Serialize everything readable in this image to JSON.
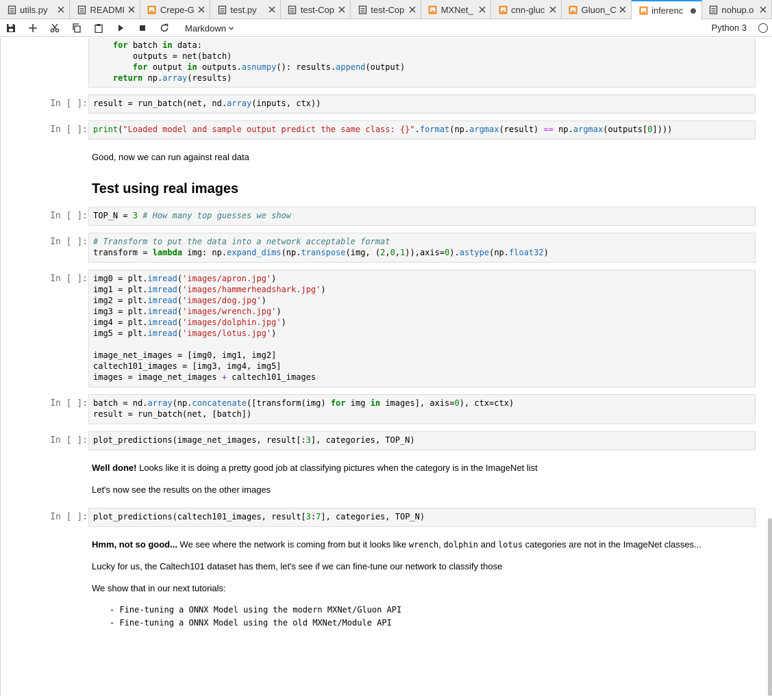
{
  "tabs": [
    {
      "label": "utils.py",
      "icon": "file-icon",
      "active": false
    },
    {
      "label": "READMI",
      "icon": "file-icon",
      "active": false
    },
    {
      "label": "Crepe-G",
      "icon": "notebook-icon",
      "active": false
    },
    {
      "label": "test.py",
      "icon": "file-icon",
      "active": false
    },
    {
      "label": "test-Cop",
      "icon": "file-icon",
      "active": false
    },
    {
      "label": "test-Cop",
      "icon": "file-icon",
      "active": false
    },
    {
      "label": "MXNet_",
      "icon": "notebook-icon",
      "active": false
    },
    {
      "label": "cnn-gluc",
      "icon": "notebook-icon",
      "active": false
    },
    {
      "label": "Gluon_C",
      "icon": "notebook-icon",
      "active": false
    },
    {
      "label": "inferenc",
      "icon": "notebook-icon",
      "active": true
    },
    {
      "label": "nohup.o",
      "icon": "file-icon",
      "active": false
    }
  ],
  "toolbar": {
    "cell_type": "Markdown",
    "kernel_name": "Python 3",
    "icons": [
      "save-icon",
      "add-cell-icon",
      "cut-icon",
      "copy-icon",
      "paste-icon",
      "run-icon",
      "stop-icon",
      "restart-icon"
    ]
  },
  "prompt_label": "In [ ]:",
  "markdown": {
    "good_now": "Good, now we can run against real data",
    "heading": "Test using real images",
    "well_done_bold": "Well done!",
    "well_done_rest": " Looks like it is doing a pretty good job at classifying pictures when the category is in the ImageNet list",
    "lets_now": "Let's now see the results on the other images",
    "hmm_bold": "Hmm, not so good...",
    "hmm_text1": " We see where the network is coming from but it looks like ",
    "hmm_code1": "wrench",
    "hmm_text2": ", ",
    "hmm_code2": "dolphin",
    "hmm_text3": " and ",
    "hmm_code3": "lotus",
    "hmm_text4": " categories are not in the ImageNet classes...",
    "lucky": "Lucky for us, the Caltech101 dataset has them, let's see if we can fine-tune our network to classify those",
    "we_show": "We show that in our next tutorials:",
    "list_item_1": "- Fine-tuning a ONNX Model using the modern MXNet/Gluon API",
    "list_item_2": "- Fine-tuning a ONNX Model using the old MXNet/Module API"
  },
  "code": {
    "c0_l1_kw": "for",
    "c0_l1_a": " batch ",
    "c0_l1_kw2": "in",
    "c0_l1_b": " data:",
    "c0_l2": "    outputs = net(batch)",
    "c0_l3_kw": "for",
    "c0_l3_a": " output ",
    "c0_l3_kw2": "in",
    "c0_l3_b": " outputs.",
    "c0_l3_f": "asnumpy",
    "c0_l3_c": "(): results.",
    "c0_l3_f2": "append",
    "c0_l3_d": "(output)",
    "c0_l4_kw": "return",
    "c0_l4_a": " np.",
    "c0_l4_f": "array",
    "c0_l4_b": "(results)",
    "c1_a": "result = run_batch(net, nd.",
    "c1_f": "array",
    "c1_b": "(inputs, ctx))",
    "c2_f": "print",
    "c2_a": "(",
    "c2_s": "\"Loaded model and sample output predict the same class: {}\"",
    "c2_b": ".",
    "c2_f2": "format",
    "c2_c": "(np.",
    "c2_f3": "argmax",
    "c2_d": "(result) ",
    "c2_o": "==",
    "c2_e": " np.",
    "c2_f4": "argmax",
    "c2_g": "(outputs[",
    "c2_n": "0",
    "c2_h": "])))",
    "c3_a": "TOP_N = ",
    "c3_n": "3",
    "c3_c": " # How many top guesses we show",
    "c4_c": "# Transform to put the data into a network acceptable format",
    "c4_a": "transform = ",
    "c4_k": "lambda",
    "c4_b": " img: np.",
    "c4_f1": "expand_dims",
    "c4_c2": "(np.",
    "c4_f2": "transpose",
    "c4_d": "(img, (",
    "c4_n1": "2",
    "c4_e": ",",
    "c4_n2": "0",
    "c4_g": ",",
    "c4_n3": "1",
    "c4_h": ")),axis=",
    "c4_n4": "0",
    "c4_i": ").",
    "c4_f3": "astype",
    "c4_j": "(np.",
    "c4_f4": "float32",
    "c4_l": ")",
    "c5_imgs": [
      {
        "var": "img0",
        "path": "'images/apron.jpg'"
      },
      {
        "var": "img1",
        "path": "'images/hammerheadshark.jpg'"
      },
      {
        "var": "img2",
        "path": "'images/dog.jpg'"
      },
      {
        "var": "img3",
        "path": "'images/wrench.jpg'"
      },
      {
        "var": "img4",
        "path": "'images/dolphin.jpg'"
      },
      {
        "var": "img5",
        "path": "'images/lotus.jpg'"
      }
    ],
    "c5_eq": " = plt.",
    "c5_f": "imread",
    "c5_open": "(",
    "c5_close": ")",
    "c5_l7": "image_net_images = [img0, img1, img2]",
    "c5_l8": "caltech101_images = [img3, img4, img5]",
    "c5_l9_a": "images = image_net_images ",
    "c5_l9_o": "+",
    "c5_l9_b": " caltech101_images",
    "c6_l1_a": "batch = nd.",
    "c6_l1_f": "array",
    "c6_l1_b": "(np.",
    "c6_l1_f2": "concatenate",
    "c6_l1_c": "([transform(img) ",
    "c6_l1_k": "for",
    "c6_l1_d": " img ",
    "c6_l1_k2": "in",
    "c6_l1_e": " images], axis=",
    "c6_l1_n": "0",
    "c6_l1_g": "), ctx=ctx)",
    "c6_l2": "result = run_batch(net, [batch])",
    "c7_a": "plot_predictions(image_net_images, result[:",
    "c7_n": "3",
    "c7_b": "], categories, TOP_N)",
    "c8_a": "plot_predictions(caltech101_images, result[",
    "c8_n1": "3",
    "c8_o": ":",
    "c8_n2": "7",
    "c8_b": "], categories, TOP_N)"
  }
}
